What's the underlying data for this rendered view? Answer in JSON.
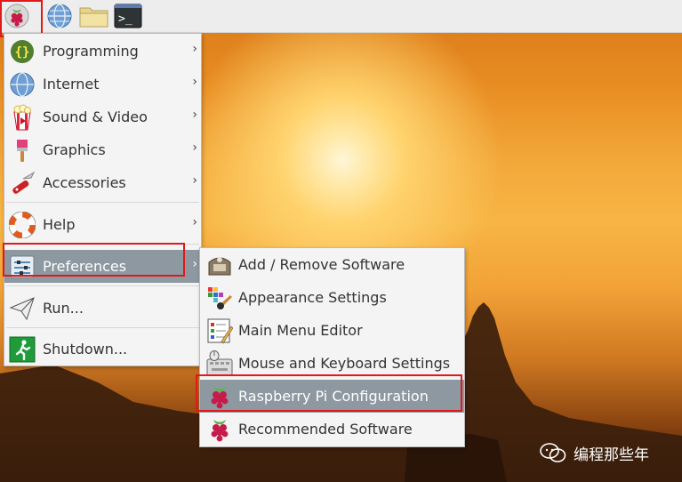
{
  "main_menu": [
    {
      "label": "Programming",
      "icon": "programming-icon",
      "submenu": true
    },
    {
      "label": "Internet",
      "icon": "globe-icon",
      "submenu": true
    },
    {
      "label": "Sound & Video",
      "icon": "popcorn-icon",
      "submenu": true
    },
    {
      "label": "Graphics",
      "icon": "paintbrush-icon",
      "submenu": true
    },
    {
      "label": "Accessories",
      "icon": "knife-icon",
      "submenu": true
    },
    {
      "label": "Help",
      "icon": "lifebuoy-icon",
      "submenu": true
    },
    {
      "label": "Preferences",
      "icon": "preferences-icon",
      "submenu": true,
      "selected": true
    },
    {
      "label": "Run...",
      "icon": "paper-plane-icon",
      "submenu": false
    },
    {
      "label": "Shutdown...",
      "icon": "exit-icon",
      "submenu": false
    }
  ],
  "preferences_submenu": [
    {
      "label": "Add / Remove Software",
      "icon": "package-icon"
    },
    {
      "label": "Appearance Settings",
      "icon": "palette-icon"
    },
    {
      "label": "Main Menu Editor",
      "icon": "menu-editor-icon"
    },
    {
      "label": "Mouse and Keyboard Settings",
      "icon": "keyboard-mouse-icon"
    },
    {
      "label": "Raspberry Pi Configuration",
      "icon": "raspberry-icon",
      "selected": true
    },
    {
      "label": "Recommended Software",
      "icon": "raspberry-icon"
    }
  ],
  "chevron": "›",
  "watermark": {
    "text": "编程那些年",
    "icon": "wechat-icon"
  },
  "colors": {
    "selection": "#8d98a0",
    "highlight_box": "#e0191b",
    "raspberry": "#c51a4a"
  }
}
